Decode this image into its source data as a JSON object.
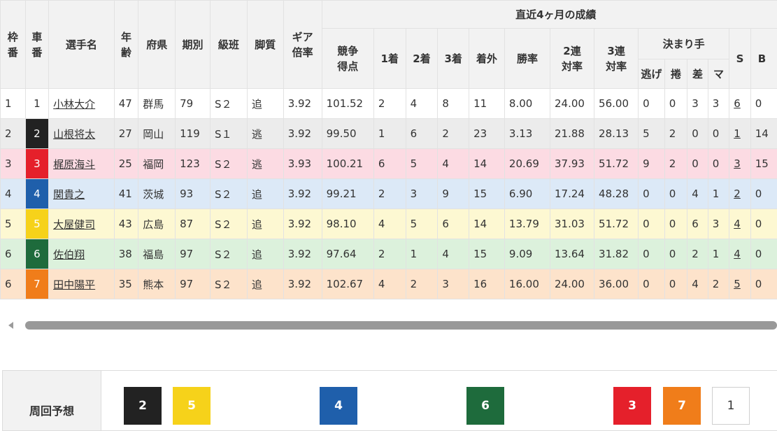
{
  "header": {
    "frame": "枠\n番",
    "car": "車\n番",
    "name": "選手名",
    "age": "年\n齢",
    "pref": "府県",
    "term": "期別",
    "class": "級班",
    "style": "脚質",
    "gear": "ギア\n倍率",
    "recent_title": "直近4ヶ月の成績",
    "score": "競争\n得点",
    "first": "1着",
    "second": "2着",
    "third": "3着",
    "out": "着外",
    "win_rate": "勝率",
    "quinella_rate": "2連\n対率",
    "trio_rate": "3連\n対率",
    "kimarite": "決まり手",
    "nige": "逃げ",
    "makuri": "捲",
    "sashi": "差",
    "mark": "マ",
    "s": "S",
    "b": "B"
  },
  "rows": [
    {
      "frame": "1",
      "car": "1",
      "name": "小林大介",
      "age": "47",
      "pref": "群馬",
      "term": "79",
      "class": "S２",
      "style": "追",
      "gear": "3.92",
      "score": "101.52",
      "first": "2",
      "second": "4",
      "third": "8",
      "out": "11",
      "win_rate": "8.00",
      "quinella_rate": "24.00",
      "trio_rate": "56.00",
      "nige": "0",
      "makuri": "0",
      "sashi": "3",
      "mark": "3",
      "s": "6",
      "b": "0"
    },
    {
      "frame": "2",
      "car": "2",
      "name": "山根将太",
      "age": "27",
      "pref": "岡山",
      "term": "119",
      "class": "S１",
      "style": "逃",
      "gear": "3.92",
      "score": "99.50",
      "first": "1",
      "second": "6",
      "third": "2",
      "out": "23",
      "win_rate": "3.13",
      "quinella_rate": "21.88",
      "trio_rate": "28.13",
      "nige": "5",
      "makuri": "2",
      "sashi": "0",
      "mark": "0",
      "s": "1",
      "b": "14"
    },
    {
      "frame": "3",
      "car": "3",
      "name": "梶原海斗",
      "age": "25",
      "pref": "福岡",
      "term": "123",
      "class": "S２",
      "style": "逃",
      "gear": "3.93",
      "score": "100.21",
      "first": "6",
      "second": "5",
      "third": "4",
      "out": "14",
      "win_rate": "20.69",
      "quinella_rate": "37.93",
      "trio_rate": "51.72",
      "nige": "9",
      "makuri": "2",
      "sashi": "0",
      "mark": "0",
      "s": "3",
      "b": "15"
    },
    {
      "frame": "4",
      "car": "4",
      "name": "関貴之",
      "age": "41",
      "pref": "茨城",
      "term": "93",
      "class": "S２",
      "style": "追",
      "gear": "3.92",
      "score": "99.21",
      "first": "2",
      "second": "3",
      "third": "9",
      "out": "15",
      "win_rate": "6.90",
      "quinella_rate": "17.24",
      "trio_rate": "48.28",
      "nige": "0",
      "makuri": "0",
      "sashi": "4",
      "mark": "1",
      "s": "2",
      "b": "0"
    },
    {
      "frame": "5",
      "car": "5",
      "name": "大屋健司",
      "age": "43",
      "pref": "広島",
      "term": "87",
      "class": "S２",
      "style": "追",
      "gear": "3.92",
      "score": "98.10",
      "first": "4",
      "second": "5",
      "third": "6",
      "out": "14",
      "win_rate": "13.79",
      "quinella_rate": "31.03",
      "trio_rate": "51.72",
      "nige": "0",
      "makuri": "0",
      "sashi": "6",
      "mark": "3",
      "s": "4",
      "b": "0"
    },
    {
      "frame": "6",
      "car": "6",
      "name": "佐伯翔",
      "age": "38",
      "pref": "福島",
      "term": "97",
      "class": "S２",
      "style": "追",
      "gear": "3.92",
      "score": "97.64",
      "first": "2",
      "second": "1",
      "third": "4",
      "out": "15",
      "win_rate": "9.09",
      "quinella_rate": "13.64",
      "trio_rate": "31.82",
      "nige": "0",
      "makuri": "0",
      "sashi": "2",
      "mark": "1",
      "s": "4",
      "b": "0"
    },
    {
      "frame": "6",
      "car": "7",
      "name": "田中陽平",
      "age": "35",
      "pref": "熊本",
      "term": "97",
      "class": "S２",
      "style": "追",
      "gear": "3.92",
      "score": "102.67",
      "first": "4",
      "second": "2",
      "third": "3",
      "out": "16",
      "win_rate": "16.00",
      "quinella_rate": "24.00",
      "trio_rate": "36.00",
      "nige": "0",
      "makuri": "0",
      "sashi": "4",
      "mark": "2",
      "s": "5",
      "b": "0"
    }
  ],
  "prediction": {
    "label": "周回予想",
    "boxes": [
      {
        "num": "2",
        "color": "#222222"
      },
      {
        "num": "5",
        "color": "#f6d21a"
      },
      {
        "num": "4",
        "color": "#1f5fab"
      },
      {
        "num": "6",
        "color": "#1e6b3c"
      },
      {
        "num": "3",
        "color": "#e5202b"
      },
      {
        "num": "7",
        "color": "#f07d1a"
      },
      {
        "num": "1",
        "color": "#ffffff"
      }
    ]
  }
}
